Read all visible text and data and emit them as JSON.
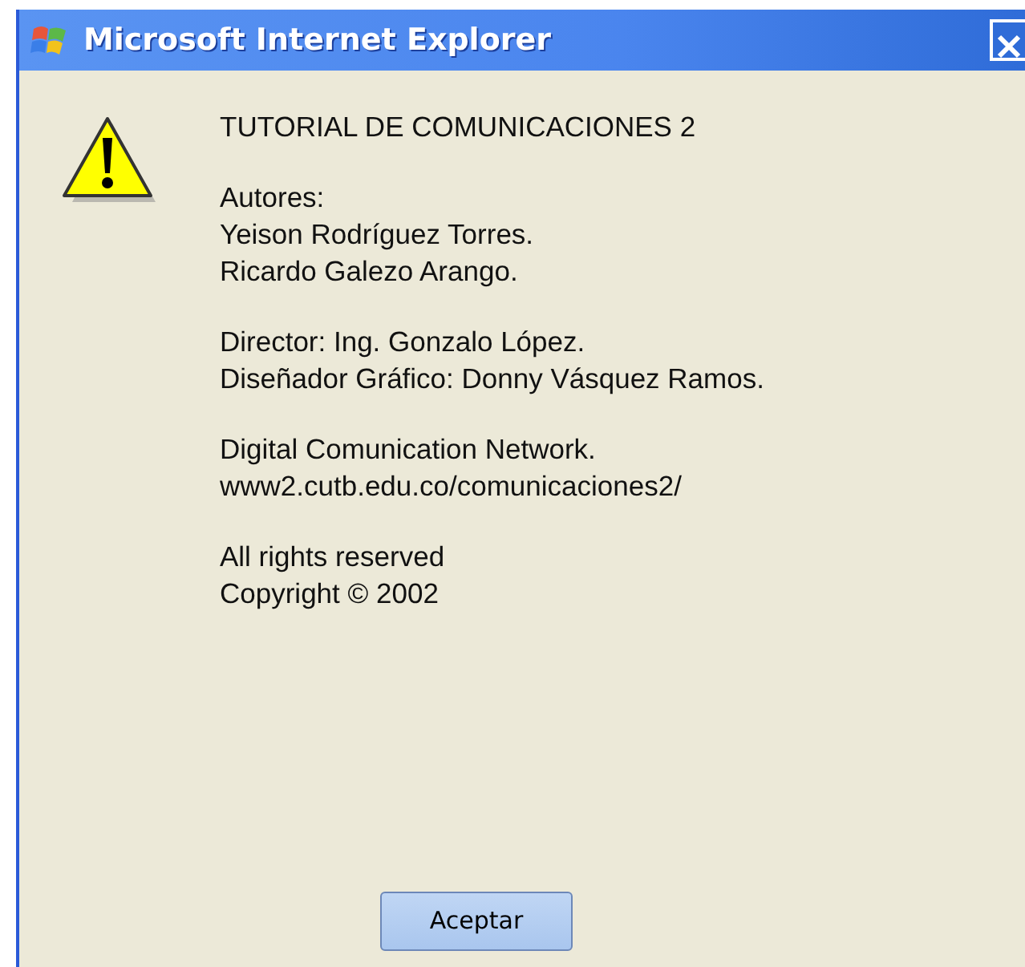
{
  "window": {
    "title": "Microsoft Internet Explorer"
  },
  "message": {
    "heading": "TUTORIAL DE COMUNICACIONES 2",
    "paragraphs": [
      [
        "Autores:",
        "Yeison Rodríguez Torres.",
        "Ricardo Galezo Arango."
      ],
      [
        "Director: Ing. Gonzalo López.",
        "Diseñador Gráfico: Donny Vásquez Ramos."
      ],
      [
        "Digital Comunication Network.",
        "www2.cutb.edu.co/comunicaciones2/"
      ],
      [
        "All rights reserved",
        "Copyright © 2002"
      ]
    ]
  },
  "buttons": [
    "Aceptar"
  ]
}
